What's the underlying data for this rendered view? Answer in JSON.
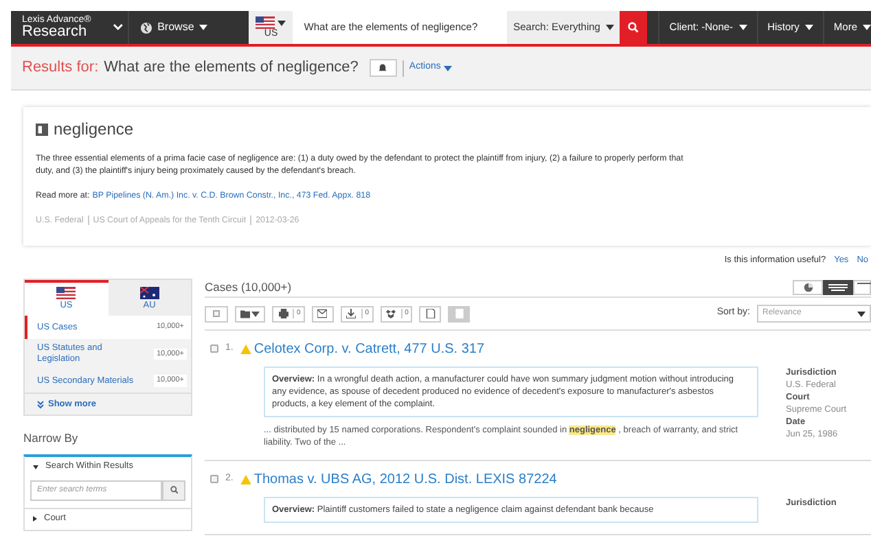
{
  "nav": {
    "brand_top": "Lexis Advance®",
    "brand_bottom": "Research",
    "browse": "Browse",
    "jurisdiction": "US",
    "query": "What are the elements of negligence?",
    "search_scope": "Search: Everything",
    "client": "Client: -None-",
    "history": "History",
    "more": "More"
  },
  "results_bar": {
    "label": "Results for:",
    "query": "What are the elements of negligence?",
    "actions": "Actions"
  },
  "definition": {
    "term": "negligence",
    "text": "The three essential elements of a prima facie case of negligence are: (1) a duty owed by the defendant to protect the plaintiff from injury, (2) a failure to properly perform that duty, and (3) the plaintiff's injury being proximately caused by the defendant's breach.",
    "read_more_label": "Read more at:",
    "read_more_link": "BP Pipelines (N. Am.) Inc. v. C.D. Brown Constr., Inc., 473 Fed. Appx. 818",
    "meta": [
      "U.S. Federal",
      "US Court of Appeals for the Tenth Circuit",
      "2012-03-26"
    ]
  },
  "feedback": {
    "question": "Is this information useful?",
    "yes": "Yes",
    "no": "No"
  },
  "sidebar": {
    "tabs": [
      {
        "label": "US",
        "selected": true
      },
      {
        "label": "AU",
        "selected": false
      }
    ],
    "categories": [
      {
        "label": "US Cases",
        "count": "10,000+",
        "selected": true
      },
      {
        "label": "US Statutes and Legislation",
        "count": "10,000+",
        "selected": false
      },
      {
        "label": "US Secondary Materials",
        "count": "10,000+",
        "selected": false
      }
    ],
    "show_more": "Show more",
    "narrow_by": "Narrow By",
    "filters": [
      {
        "label": "Search Within Results",
        "expanded": true,
        "placeholder": "Enter search terms"
      },
      {
        "label": "Court",
        "expanded": false
      }
    ]
  },
  "results": {
    "heading": "Cases (10,000+)",
    "select_all_checked": false,
    "toolbar_counts": [
      "0",
      "0",
      "0"
    ],
    "sort_label": "Sort by:",
    "sort_value": "Relevance",
    "items": [
      {
        "checked": false,
        "number": "1.",
        "title": "Celotex Corp. v. Catrett, 477 U.S. 317",
        "overview_label": "Overview:",
        "overview": "In a wrongful death action, a manufacturer could have won summary judgment motion without introducing any evidence, as spouse of decedent produced no evidence of decedent's exposure to manufacturer's asbestos products, a key element of the complaint.",
        "snippet_before": "... distributed by 15 named corporations. Respondent's complaint sounded in",
        "snippet_highlight": "negligence",
        "snippet_after": ", breach of warranty, and strict liability. Two of the ...",
        "facts": [
          {
            "label": "Jurisdiction",
            "value": "U.S. Federal"
          },
          {
            "label": "Court",
            "value": "Supreme Court"
          },
          {
            "label": "Date",
            "value": "Jun 25, 1986"
          }
        ]
      },
      {
        "checked": false,
        "number": "2.",
        "title": "Thomas v. UBS AG, 2012 U.S. Dist. LEXIS 87224",
        "overview_label": "Overview:",
        "overview": "Plaintiff customers failed to state a negligence claim against defendant bank because",
        "facts": [
          {
            "label": "Jurisdiction"
          }
        ]
      }
    ]
  }
}
